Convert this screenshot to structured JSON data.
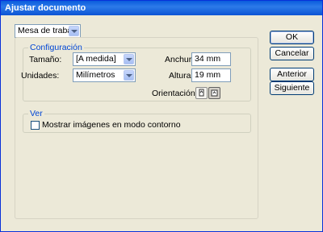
{
  "window": {
    "title": "Ajustar documento"
  },
  "top_select": {
    "value": "Mesa de trabajo"
  },
  "config": {
    "legend": "Configuración",
    "size_label": "Tamaño:",
    "size_value": "[A medida]",
    "units_label": "Unidades:",
    "units_value": "Milímetros",
    "width_label": "Anchura:",
    "width_value": "34 mm",
    "height_label": "Altura:",
    "height_value": "19 mm",
    "orientation_label": "Orientación:"
  },
  "view": {
    "legend": "Ver",
    "outline_checkbox_label": "Mostrar imágenes en modo contorno",
    "outline_checked": false
  },
  "buttons": {
    "ok": "OK",
    "cancel": "Cancelar",
    "previous": "Anterior",
    "next": "Siguiente"
  }
}
